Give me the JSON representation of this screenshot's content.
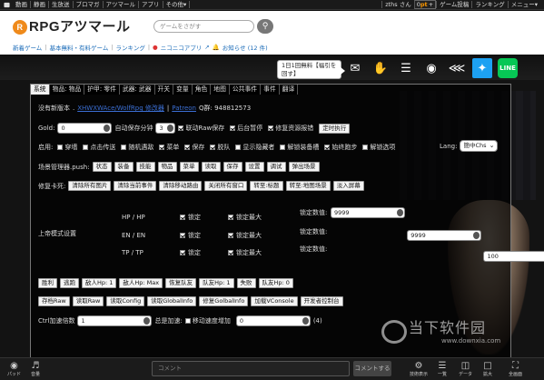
{
  "topbar": {
    "items": [
      "動画",
      "静画",
      "生放送",
      "ブロマガ",
      "アツマール",
      "アプリ",
      "その他▾"
    ],
    "user": "zths さん",
    "points_prefix": "0",
    "points_unit": "pt",
    "points_plus": "+",
    "links": [
      "ゲーム投稿",
      "ランキング",
      "メニュー▾"
    ]
  },
  "header": {
    "logo": "RPGアツマール",
    "search_placeholder": "ゲームをさがす",
    "subnav": [
      "新着ゲーム",
      "基本無料・有料ゲーム",
      "ランキング",
      "ニコニコアプリ",
      "お知らせ (12 件)"
    ]
  },
  "toolbar": {
    "tooltip": "1日1回無料【福引を回す】"
  },
  "panel": {
    "tabs": [
      "系统",
      "物品: 物品",
      "护甲: 零件",
      "武器: 武器",
      "开关",
      "变量",
      "角色",
      "地图",
      "公共事件",
      "事件",
      "翻译"
    ],
    "active_tab": 0,
    "no_new_version": "没有新版本",
    "link1": "XHWXWAce/WolfRpg 修改器",
    "link2": "Patreon",
    "qq": "Q群: 948812573",
    "lang_label": "Lang:",
    "lang_value": "簡中Chs",
    "gold_label": "Gold:",
    "gold_value": "0",
    "autosave_label": "自动保存分钟",
    "autosave_value": "3",
    "chk_raw": "联动Raw保存",
    "chk_pause": "后台暂停",
    "chk_fix": "修复资源报错",
    "btn_run": "定时执行",
    "enable_label": "启用:",
    "enable_opts": [
      "穿墙",
      "点击传送",
      "随机遇敌",
      "菜单",
      "保存",
      "脱队",
      "显示隐藏者",
      "解锁装备槽",
      "始终跑步",
      "解锁选项"
    ],
    "scene_label": "场景管理器.push:",
    "scene_btns": [
      "状态",
      "装备",
      "技能",
      "物品",
      "菜单",
      "读取",
      "保存",
      "设置",
      "调试",
      "弹出场景"
    ],
    "fix_label": "修复卡死:",
    "fix_btns": [
      "清除所有图片",
      "清除当前事件",
      "清除移动路由",
      "关闭所有窗口",
      "转至:标题",
      "转至:地图场景",
      "淡入屏幕"
    ],
    "mode_label": "上帝模式设置",
    "stats": [
      {
        "label": "HP / HP",
        "lock": "锁定",
        "lockmax": "锁定最大",
        "value_label": "锁定数值:",
        "value": "9999"
      },
      {
        "label": "EN / EN",
        "lock": "锁定",
        "lockmax": "锁定最大",
        "value_label": "锁定数值:",
        "value": "9999"
      },
      {
        "label": "TP / TP",
        "lock": "锁定",
        "lockmax": "锁定最大",
        "value_label": "锁定数值:",
        "value": "100"
      }
    ],
    "battle_btns": [
      "胜利",
      "逃跑",
      "敌人Hp: 1",
      "敌人Hp: Max",
      "恢复队友",
      "队友Hp: 1",
      "失败",
      "队友Hp: 0"
    ],
    "file_btns": [
      "存档Raw",
      "读取Raw",
      "读取Config",
      "读取GlobalInfo",
      "修复GolbalInfo",
      "加载VConsole",
      "开发者控制台"
    ],
    "ctrl_label": "Ctrl加速倍数",
    "ctrl_value": "1",
    "always_label": "总是加速:",
    "move_label": "移动速度增加",
    "move_value": "0",
    "move_suffix": "(4)"
  },
  "bottombar": {
    "left_labels": [
      "パッド",
      "音量"
    ],
    "comment_placeholder": "コメント",
    "send_label": "コメントする",
    "right_labels": [
      "技術表示",
      "一覧",
      "データ",
      "拡大",
      "全画面"
    ]
  },
  "watermark": {
    "text": "当下软件园",
    "url": "www.downxia.com"
  }
}
